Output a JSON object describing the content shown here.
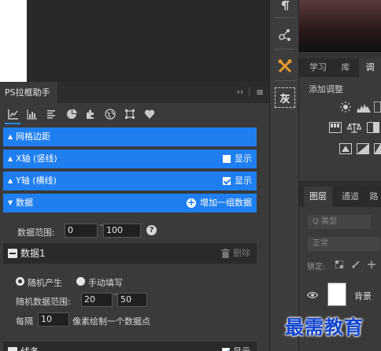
{
  "plugin": {
    "tab_title": "PS拉框助手",
    "collapse_glyph": "››",
    "menu_glyph": "≡",
    "tool_tabs": [
      "line-chart-icon",
      "bar-chart-icon",
      "list-icon",
      "pie-chart-icon",
      "puzzle-icon",
      "globe-icon",
      "frame-icon",
      "heart-icon"
    ],
    "sections": {
      "grid_margin": "网格边距",
      "x_axis": "X轴 (竖线)",
      "x_axis_show": "显示",
      "y_axis": "Y轴 (横线)",
      "y_axis_show": "显示",
      "data": "数据",
      "add_group": "增加一组数据"
    },
    "data_range": {
      "label": "数据范围:",
      "min": "0",
      "max": "100",
      "dash": "~"
    },
    "group1": {
      "title": "数据1",
      "delete": "删除",
      "random_label": "随机产生",
      "manual_label": "手动填写",
      "random_range_label": "随机数据范围:",
      "random_min": "20",
      "random_max": "50",
      "every_label": "每隔",
      "every_value": "10",
      "every_suffix": "像素绘制一个数据点"
    },
    "line_section": {
      "title": "线条",
      "show": "显示"
    },
    "accent_color": "#1f7ff0"
  },
  "right_panel": {
    "tabs": [
      "学习",
      "库",
      "调"
    ],
    "adjust_title": "添加调整",
    "layers_tabs": [
      "图层",
      "通道",
      "路"
    ],
    "type_search_placeholder": "Q 类型",
    "blend_mode": "正常",
    "lock_label": "锁定:",
    "layer_name": "背景"
  },
  "toolbar": {
    "gray_button": "灰"
  },
  "watermark": "最需教育"
}
